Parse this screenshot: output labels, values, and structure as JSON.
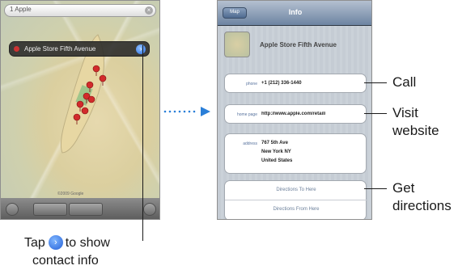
{
  "map": {
    "search_query": "1 Apple",
    "callout_title": "Apple Store Fifth Avenue",
    "disclosure_symbol": "›",
    "search_clear_symbol": "×",
    "credit": "©2009 Google"
  },
  "info": {
    "back_label": "Map",
    "nav_title": "Info",
    "place_name": "Apple Store Fifth Avenue",
    "phone_label": "phone",
    "phone_value": "+1 (212) 336-1440",
    "home_label": "home page",
    "home_value": "http://www.apple.com/retail/",
    "address_label": "address",
    "address_lines": [
      "767 5th Ave",
      "New York NY",
      "United States"
    ],
    "directions_to": "Directions To Here",
    "directions_from": "Directions From Here"
  },
  "annotations": {
    "call": "Call",
    "visit": [
      "Visit",
      "website"
    ],
    "directions": [
      "Get",
      "directions"
    ],
    "tap_prefix": "Tap",
    "tap_suffix": "to show",
    "tap_line2": "contact info"
  },
  "colors": {
    "accent_blue": "#2a6fe0",
    "pin_red": "#d22b2b",
    "nav_top": "#b4c0d0",
    "nav_bottom": "#6d84a2"
  }
}
